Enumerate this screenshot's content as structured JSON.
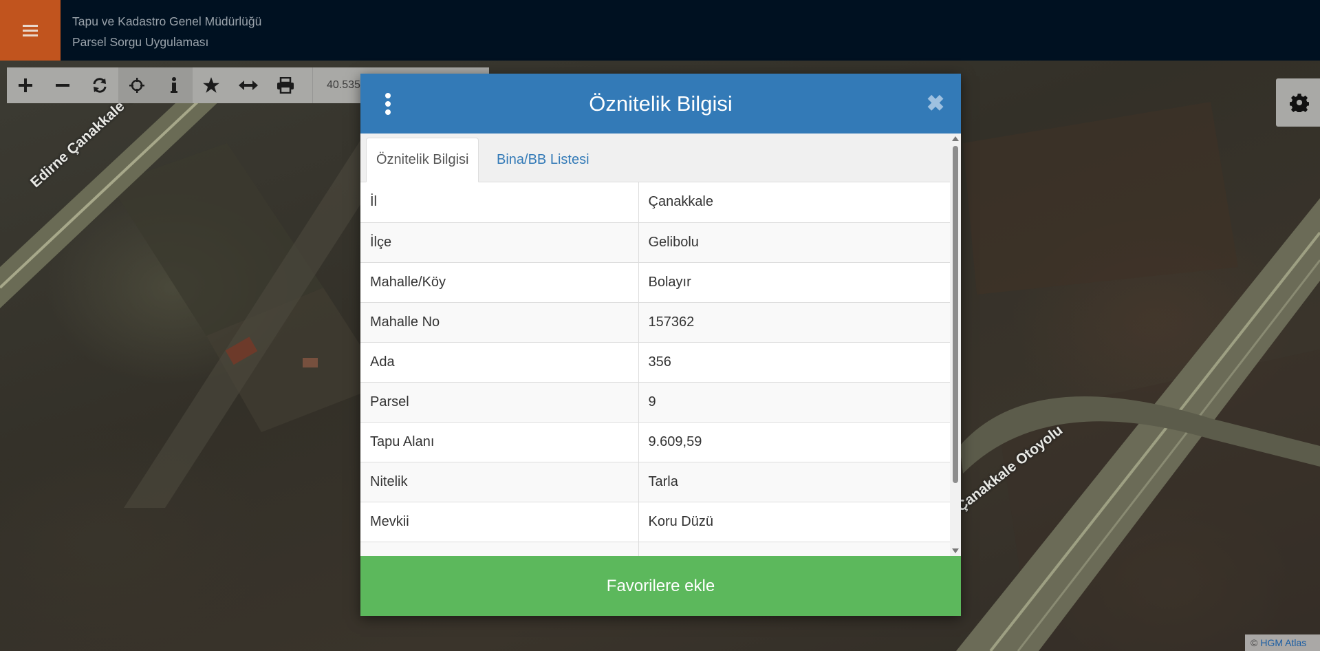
{
  "header": {
    "title_line1": "Tapu ve Kadastro Genel Müdürlüğü",
    "title_line2": "Parsel Sorgu Uygulaması",
    "menu_icon": "hamburger-icon"
  },
  "toolbar": {
    "tools": [
      {
        "name": "zoom-in",
        "icon": "plus-icon"
      },
      {
        "name": "zoom-out",
        "icon": "minus-icon"
      },
      {
        "name": "refresh",
        "icon": "refresh-icon"
      },
      {
        "name": "locate",
        "icon": "crosshair-icon"
      },
      {
        "name": "info",
        "icon": "info-icon",
        "active": true
      },
      {
        "name": "favorites",
        "icon": "star-icon"
      },
      {
        "name": "measure",
        "icon": "arrows-horizontal-icon"
      },
      {
        "name": "print",
        "icon": "print-icon"
      }
    ],
    "coordinate_text": "40.535"
  },
  "map": {
    "road_labels": [
      "Edirne Çanakkale Yolu",
      "Çanakkale Otoyolu"
    ],
    "attribution_symbol": "©",
    "attribution_link": "HGM Atlas"
  },
  "modal": {
    "title": "Öznitelik Bilgisi",
    "tabs": [
      {
        "label": "Öznitelik Bilgisi",
        "active": true
      },
      {
        "label": "Bina/BB Listesi",
        "active": false
      }
    ],
    "rows": [
      {
        "key": "İl",
        "value": "Çanakkale"
      },
      {
        "key": "İlçe",
        "value": "Gelibolu"
      },
      {
        "key": "Mahalle/Köy",
        "value": "Bolayır"
      },
      {
        "key": "Mahalle No",
        "value": "157362"
      },
      {
        "key": "Ada",
        "value": "356"
      },
      {
        "key": "Parsel",
        "value": "9"
      },
      {
        "key": "Tapu Alanı",
        "value": "9.609,59"
      },
      {
        "key": "Nitelik",
        "value": "Tarla"
      },
      {
        "key": "Mevkii",
        "value": "Koru Düzü"
      }
    ],
    "close_symbol": "✖",
    "favorite_button_label": "Favorilere ekle"
  },
  "colors": {
    "header_bg": "#001121",
    "menu_accent": "#c1541e",
    "modal_header": "#337ab7",
    "favorite_button": "#5cb85c"
  }
}
